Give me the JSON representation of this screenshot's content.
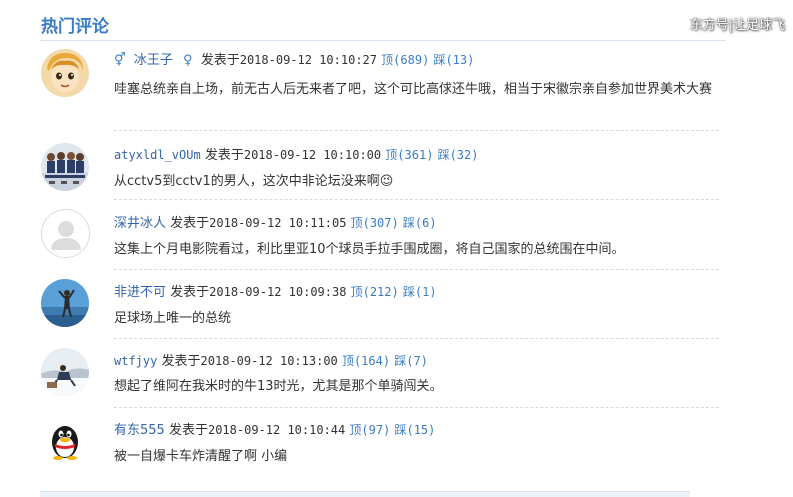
{
  "section": {
    "title": "热门评论",
    "watermark": "东方号|让足球飞"
  },
  "labels": {
    "posted_at": "发表于",
    "up": "顶",
    "down": "踩"
  },
  "comments": [
    {
      "gender_icon": "⚥",
      "username": "冰王子",
      "gender_icon2": "♀",
      "time": "2018-09-12 10:10:27",
      "up": "(689)",
      "down": "(13)",
      "content": "哇塞总统亲自上场，前无古人后无来者了吧，这个可比高俅还牛哦，相当于宋徽宗亲自参加世界美术大赛",
      "avatar": "cartoon-boy"
    },
    {
      "username": "atyxldl_vOUm",
      "time": "2018-09-12 10:10:00",
      "up": "(361)",
      "down": "(32)",
      "content": "从cctv5到cctv1的男人，这次中非论坛没来啊😉",
      "avatar": "team-photo"
    },
    {
      "username": "深井冰人",
      "time": "2018-09-12 10:11:05",
      "up": "(307)",
      "down": "(6)",
      "content": "这集上个月电影院看过，利比里亚10个球员手拉手围成圈，将自己国家的总统围在中间。",
      "avatar": "default-user"
    },
    {
      "username": "非进不可",
      "time": "2018-09-12 10:09:38",
      "up": "(212)",
      "down": "(1)",
      "content": "足球场上唯一的总统",
      "avatar": "beach-figure"
    },
    {
      "username": "wtfjyy",
      "time": "2018-09-12 10:13:00",
      "up": "(164)",
      "down": "(7)",
      "content": "想起了维阿在我米时的牛13时光，尤其是那个单骑闯关。",
      "avatar": "snow-photo"
    },
    {
      "username": "有东555",
      "time": "2018-09-12 10:10:44",
      "up": "(97)",
      "down": "(15)",
      "content": "被一自爆卡车炸清醒了啊 小编",
      "avatar": "qq-penguin"
    }
  ],
  "colors": {
    "link": "#3565a8",
    "accent": "#3b7dc4"
  }
}
